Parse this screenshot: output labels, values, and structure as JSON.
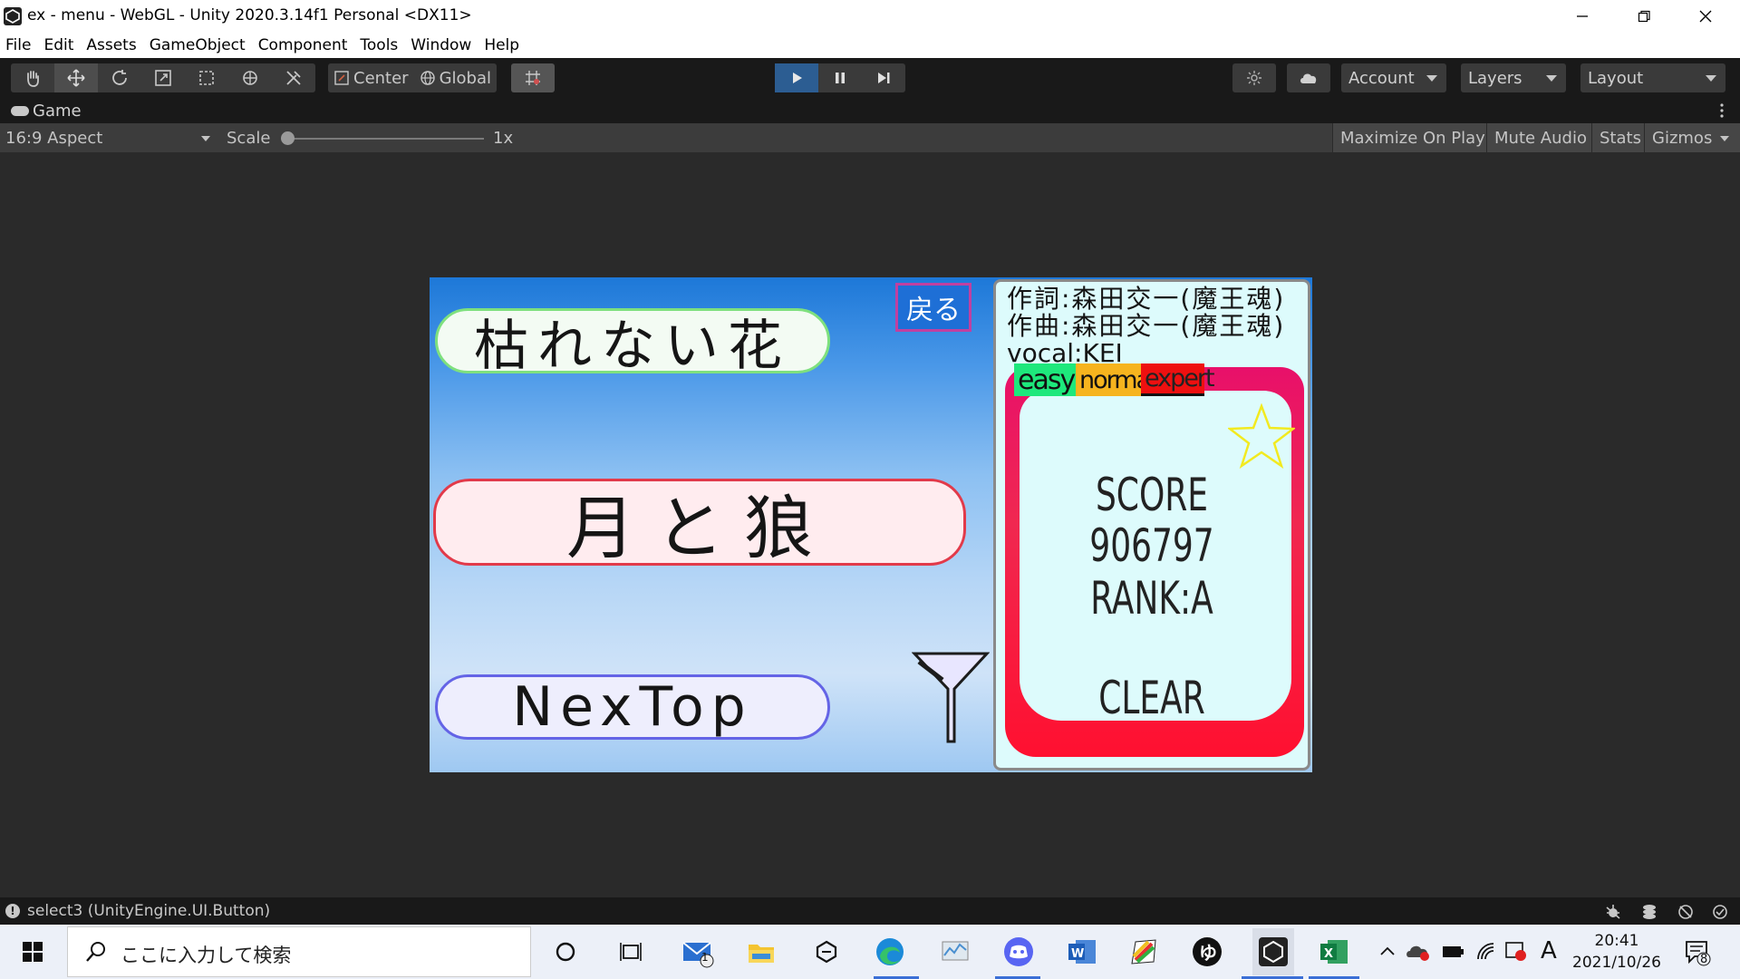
{
  "window": {
    "title": "ex - menu - WebGL - Unity 2020.3.14f1 Personal <DX11>"
  },
  "menubar": {
    "items": [
      "File",
      "Edit",
      "Assets",
      "GameObject",
      "Component",
      "Tools",
      "Window",
      "Help"
    ]
  },
  "toolbar": {
    "pivot": "Center",
    "space": "Global",
    "account": "Account",
    "layers": "Layers",
    "layout": "Layout"
  },
  "game_tab": {
    "label": "Game"
  },
  "game_options": {
    "aspect": "16:9 Aspect",
    "scale_label": "Scale",
    "scale_value": "1x",
    "maximize": "Maximize On Play",
    "mute": "Mute Audio",
    "stats": "Stats",
    "gizmos": "Gizmos"
  },
  "game": {
    "songs": [
      "枯れない花",
      "月と狼",
      "NexTop"
    ],
    "back_label": "戻る",
    "info": {
      "lyricist": "作詞:森田交一(魔王魂)",
      "composer": "作曲:森田交一(魔王魂)",
      "vocal": "vocal:KEI",
      "difficulties": [
        "easy",
        "normal",
        "expert"
      ],
      "score_label": "SCORE",
      "score_value": "906797",
      "rank": "RANK:A",
      "result": "CLEAR"
    }
  },
  "status": {
    "message": "select3 (UnityEngine.UI.Button)"
  },
  "taskbar": {
    "search_placeholder": "ここに入力して検索",
    "mail_badge": "1",
    "ime_label": "A",
    "time": "20:41",
    "date": "2021/10/26",
    "notifications": "8"
  }
}
